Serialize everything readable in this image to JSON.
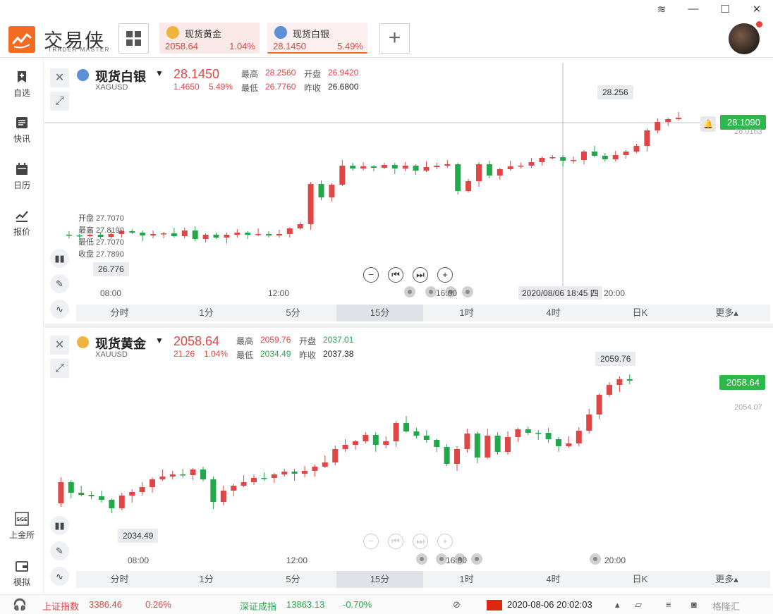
{
  "app": {
    "brand": "交易侠",
    "brand_sub": "TRADER MASTER"
  },
  "tabs": [
    {
      "name": "现货黄金",
      "price": "2058.64",
      "pct": "1.04%"
    },
    {
      "name": "现货白银",
      "price": "28.1450",
      "pct": "5.49%"
    }
  ],
  "sidebar": [
    {
      "label": "自选",
      "icon": "bookmark-plus-icon"
    },
    {
      "label": "快讯",
      "icon": "news-list-icon"
    },
    {
      "label": "日历",
      "icon": "calendar-icon"
    },
    {
      "label": "报价",
      "icon": "line-chart-icon"
    },
    {
      "label": "上金所",
      "icon": "sge-icon"
    },
    {
      "label": "模拟",
      "icon": "wallet-icon"
    }
  ],
  "silver": {
    "title": "现货白银",
    "code": "XAGUSD",
    "price": "28.1450",
    "chg": "1.4650",
    "chgp": "5.49%",
    "high_l": "最高",
    "high": "28.2560",
    "open_l": "开盘",
    "open": "26.9420",
    "low_l": "最低",
    "low": "26.7760",
    "prev_l": "昨收",
    "prev": "26.6800",
    "peak": "28.256",
    "last_tag": "28.1090",
    "ref": "28.0163",
    "trough": "26.776",
    "cross_time": "2020/08/06 18:45 四",
    "ohlc": [
      "开盘 27.7070",
      "最高 27.8190",
      "最低 27.7070",
      "收盘 27.7890"
    ],
    "x_labels": [
      "08:00",
      "12:00",
      "16:00",
      "20:00"
    ]
  },
  "gold": {
    "title": "现货黄金",
    "code": "XAUUSD",
    "price": "2058.64",
    "chg": "21.26",
    "chgp": "1.04%",
    "high_l": "最高",
    "high": "2059.76",
    "open_l": "开盘",
    "open": "2037.01",
    "low_l": "最低",
    "low": "2034.49",
    "prev_l": "昨收",
    "prev": "2037.38",
    "peak": "2059.76",
    "last_tag": "2058.64",
    "ref": "2054.07",
    "trough": "2034.49",
    "x_labels": [
      "08:00",
      "12:00",
      "16:00",
      "20:00"
    ]
  },
  "timeframes": [
    "分时",
    "1分",
    "5分",
    "15分",
    "1时",
    "4时",
    "日K",
    "更多▴"
  ],
  "selected_tf": "15分",
  "status": {
    "idx1_name": "上证指数",
    "idx1_val": "3386.46",
    "idx1_pct": "0.26%",
    "idx2_name": "深证成指",
    "idx2_val": "13863.13",
    "idx2_pct": "-0.70%",
    "datetime": "2020-08-06 20:02:03",
    "watermark": "格隆汇"
  },
  "colors": {
    "up": "#e04646",
    "down": "#22a84a",
    "accent": "#f26b21"
  }
}
